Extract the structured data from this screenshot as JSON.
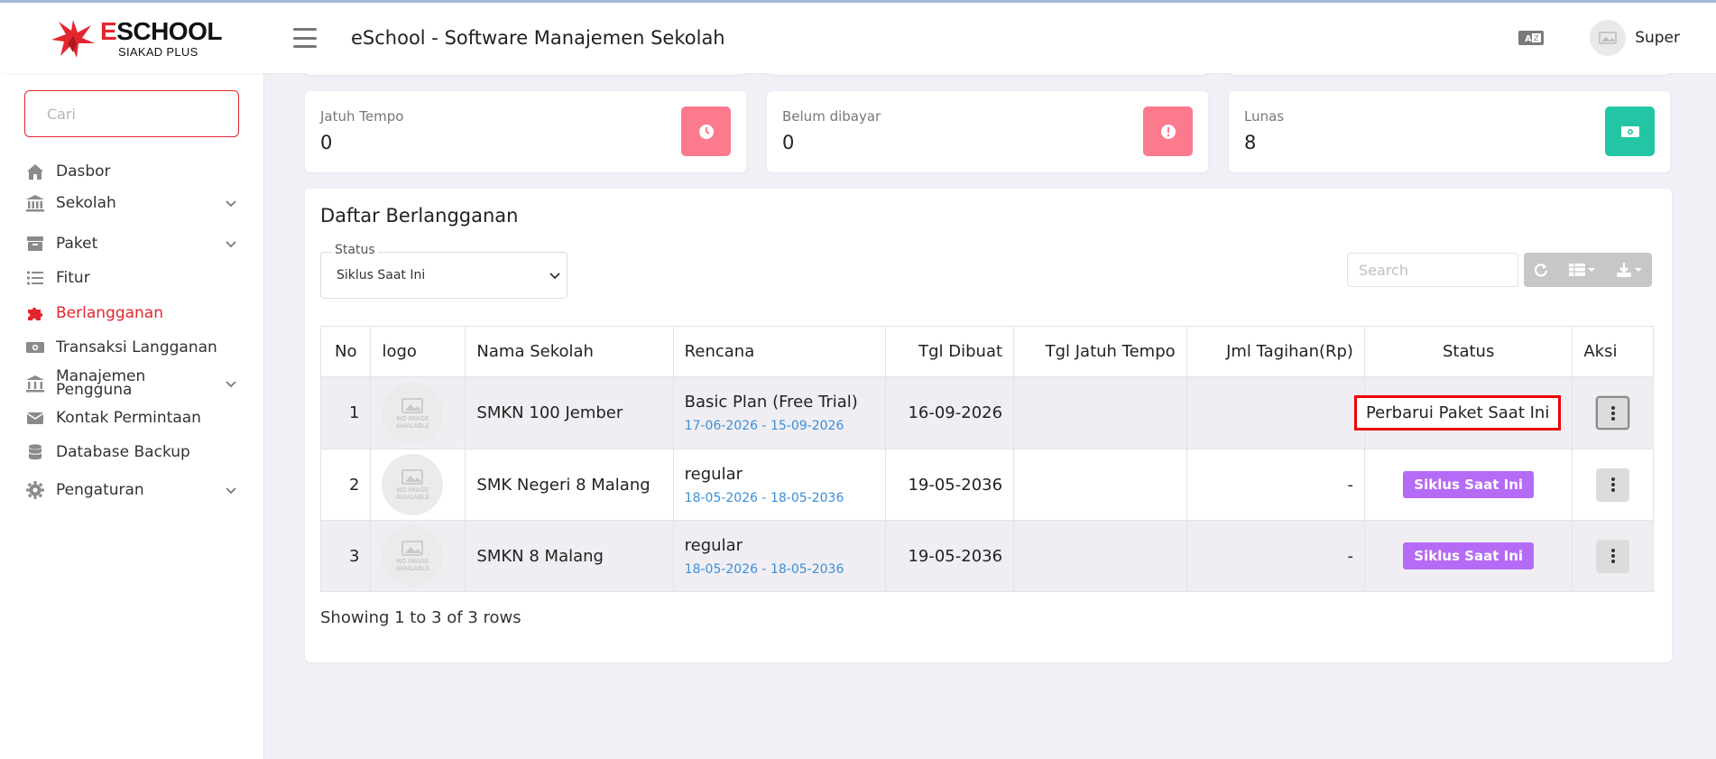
{
  "header": {
    "brand_name_e": "E",
    "brand_name_rest": "SCHOOL",
    "brand_sub": "SIAKAD PLUS",
    "app_title": "eSchool - Software Manajemen Sekolah",
    "user_name": "Super",
    "avatar_text": "NO IMAGE AVAILABLE"
  },
  "sidebar": {
    "search_placeholder": "Cari",
    "items": [
      {
        "label": "Dasbor",
        "icon": "home-icon"
      },
      {
        "label": "Sekolah",
        "icon": "bank-icon"
      },
      {
        "label": "Paket",
        "icon": "archive-icon"
      },
      {
        "label": "Fitur",
        "icon": "list-icon"
      },
      {
        "label": "Berlangganan",
        "icon": "puzzle-icon"
      },
      {
        "label": "Transaksi Langganan",
        "icon": "money-icon"
      },
      {
        "label_line1": "Manajemen",
        "label_line2": "Pengguna",
        "icon": "users-icon"
      },
      {
        "label": "Kontak Permintaan",
        "icon": "mail-icon"
      },
      {
        "label": "Database Backup",
        "icon": "database-icon"
      },
      {
        "label": "Pengaturan",
        "icon": "gear-icon"
      }
    ],
    "active_color": "#e3252f"
  },
  "stats": [
    {
      "label": "Jatuh Tempo",
      "value": "0",
      "color": "#fb7a8e",
      "icon": "clock-icon"
    },
    {
      "label": "Belum dibayar",
      "value": "0",
      "color": "#fb7a8e",
      "icon": "alert-icon"
    },
    {
      "label": "Lunas",
      "value": "8",
      "color": "#23c6a4",
      "icon": "cash-icon"
    }
  ],
  "panel": {
    "title": "Daftar Berlangganan",
    "status_label": "Status",
    "status_value": "Siklus Saat Ini",
    "search_placeholder": "Search",
    "columns": [
      "No",
      "logo",
      "Nama Sekolah",
      "Rencana",
      "Tgl Dibuat",
      "Tgl Jatuh Tempo",
      "Jml Tagihan(Rp)",
      "Status",
      "Aksi"
    ],
    "rows": [
      {
        "no": "1",
        "school": "SMKN 100 Jember",
        "plan": "Basic Plan (Free Trial)",
        "range": "17-06-2026 - 15-09-2026",
        "created": "16-09-2026",
        "due": "",
        "amount": "",
        "status": "Perbarui Paket Saat Ini"
      },
      {
        "no": "2",
        "school": "SMK Negeri 8 Malang",
        "plan": "regular",
        "range": "18-05-2026 - 18-05-2036",
        "created": "19-05-2036",
        "due": "",
        "amount": "-",
        "status": "Siklus Saat Ini"
      },
      {
        "no": "3",
        "school": "SMKN 8 Malang",
        "plan": "regular",
        "range": "18-05-2026 - 18-05-2036",
        "created": "19-05-2036",
        "due": "",
        "amount": "-",
        "status": "Siklus Saat Ini"
      }
    ],
    "noimg_text_1": "NO IMAGE",
    "noimg_text_2": "AVAILABLE",
    "footer": "Showing 1 to 3 of 3 rows",
    "badge_color": "#b56bf5"
  }
}
